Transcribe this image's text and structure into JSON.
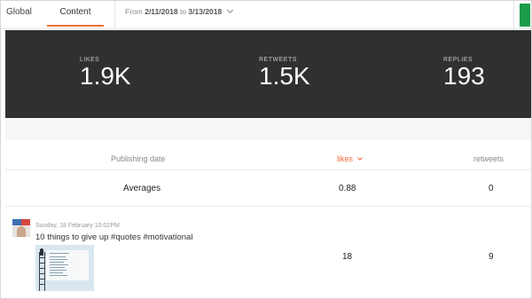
{
  "tabs": {
    "global": "Global",
    "content": "Content"
  },
  "date_range": {
    "prefix": "From",
    "start": "2/11/2018",
    "connector": "to",
    "end": "3/13/2018"
  },
  "stats": {
    "likes_label": "LIKES",
    "likes_value": "1.9K",
    "retweets_label": "RETWEETS",
    "retweets_value": "1.5K",
    "replies_label": "REPLIES",
    "replies_value": "193"
  },
  "table": {
    "columns": {
      "publishing_date": "Publishing date",
      "likes": "likes",
      "retweets": "retweets"
    },
    "averages": {
      "label": "Averages",
      "likes": "0.88",
      "retweets": "0"
    },
    "rows": [
      {
        "date": "Sunday, 18 February 10:02PM",
        "text": "10 things to give up #quotes #motivational",
        "likes": "18",
        "retweets": "9"
      }
    ]
  },
  "colors": {
    "accent": "#ef6c3a",
    "stats_bg": "#2f3032",
    "status_green": "#1c9b49"
  },
  "icons": {
    "sort": "chevron-down-icon",
    "date_dropdown": "chevron-down-icon"
  }
}
